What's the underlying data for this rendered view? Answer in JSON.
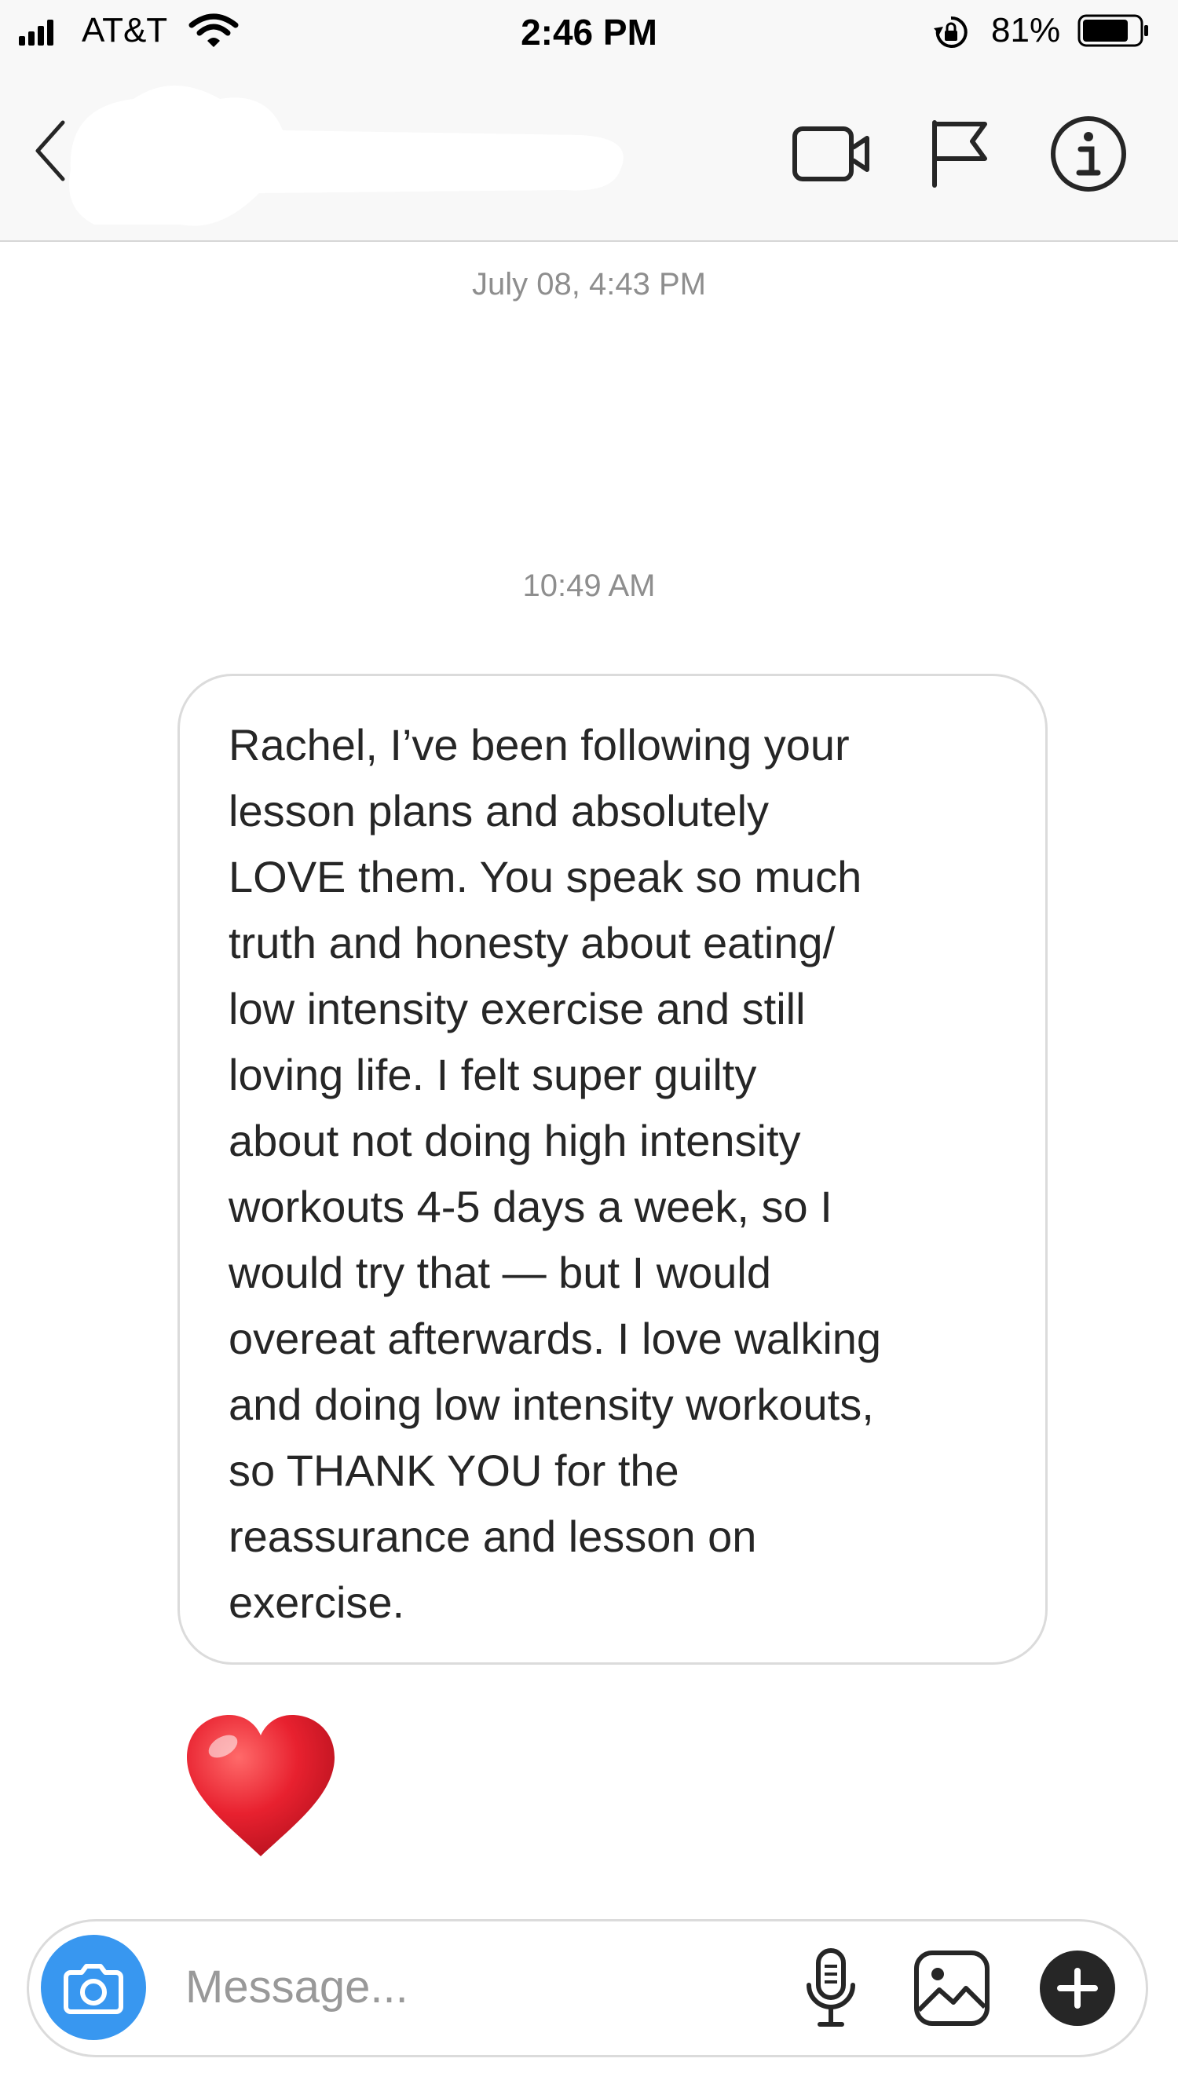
{
  "status_bar": {
    "carrier": "AT&T",
    "time": "2:46 PM",
    "battery_percent": "81%",
    "battery_level": 0.81
  },
  "header": {
    "back_icon": "chevron-left-icon",
    "video_icon": "video-camera-icon",
    "flag_icon": "flag-icon",
    "info_icon": "info-icon"
  },
  "conversation": {
    "timestamps": [
      "July 08, 4:43 PM",
      "10:49 AM"
    ],
    "message": {
      "lines": [
        "Rachel, I’ve been following your",
        "lesson plans and absolutely",
        "LOVE them. You speak so much",
        "truth and honesty about eating/",
        "low intensity exercise and still",
        "loving life. I felt super guilty",
        "about not doing high intensity",
        "workouts 4-5 days a week, so I",
        "would try that — but I would",
        "overeat afterwards. I love walking",
        "and doing low intensity workouts,",
        "so THANK YOU for the",
        "reassurance and lesson on",
        "exercise."
      ]
    },
    "reaction": "❤️"
  },
  "composer": {
    "placeholder": "Message...",
    "value": ""
  },
  "colors": {
    "accent": "#3897f0",
    "heart": "#e8212f",
    "text": "#262626",
    "muted": "#8e8e8e",
    "border": "#dbdbdb"
  }
}
